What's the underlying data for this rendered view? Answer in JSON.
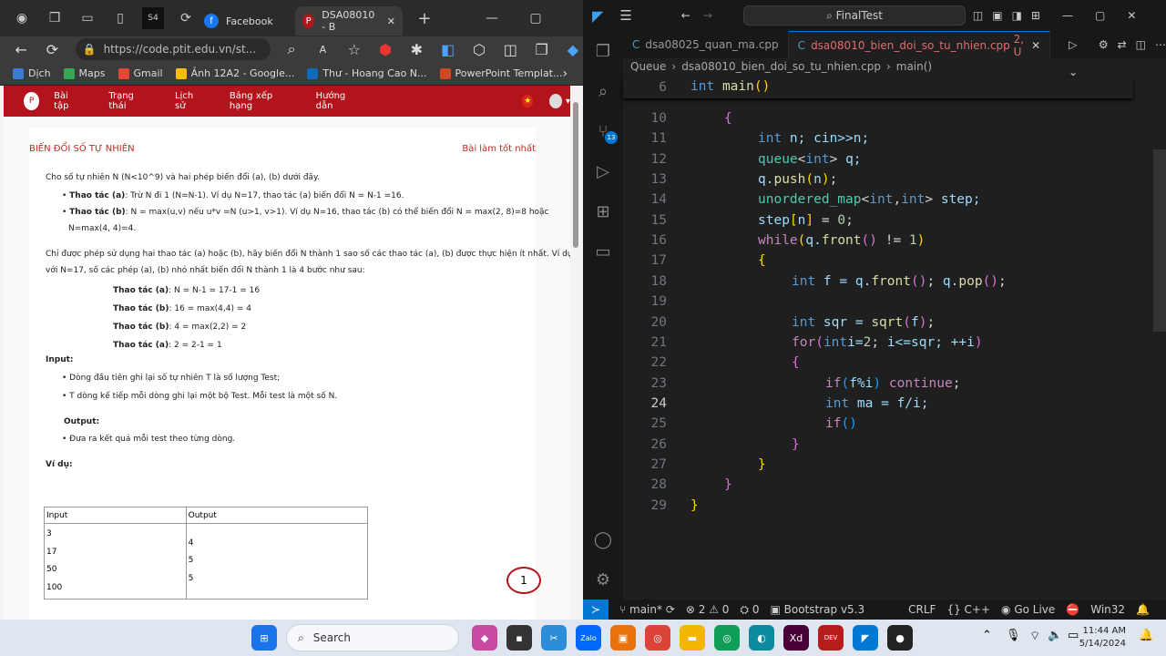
{
  "browser": {
    "tabs": [
      {
        "label": "Facebook",
        "color": "#1877f2",
        "glyph": "f"
      },
      {
        "label": "DSA08010 - B",
        "color": "#b3131b",
        "glyph": "P"
      }
    ],
    "url": "https://code.ptit.edu.vn/st...",
    "bookmarks": [
      {
        "label": "Dịch",
        "color": "#3a7bd5"
      },
      {
        "label": "Maps",
        "color": "#34a853"
      },
      {
        "label": "Gmail",
        "color": "#ea4335"
      },
      {
        "label": "Ảnh 12A2 - Google...",
        "color": "#fbbc04"
      },
      {
        "label": "Thư - Hoang Cao N...",
        "color": "#0f6cbd"
      },
      {
        "label": "PowerPoint Templat...",
        "color": "#d24726"
      }
    ]
  },
  "site": {
    "nav": [
      "Bài tập",
      "Trạng thái",
      "Lịch sử",
      "Bảng xếp hạng",
      "Hướng dẫn"
    ],
    "title": "BIẾN ĐỔI SỐ TỰ NHIÊN",
    "best": "Bài làm tốt nhất",
    "intro": "Cho số tự nhiên N (N<10^9) và hai phép biến đổi (a), (b) dưới đây.",
    "op_a_label": "Thao tác (a)",
    "op_a": ": Trừ N đi 1 (N=N-1). Ví dụ N=17, thao tác (a) biến đổi N = N-1 =16.",
    "op_b_label": "Thao tác (b)",
    "op_b1": ": N = max(u,v) nếu u*v =N (u>1, v>1). Ví dụ N=16, thao tác (b) có thể biến đổi N = max(2, 8)=8 hoặc",
    "op_b2": "N=max(4, 4)=4.",
    "para1": "Chỉ được phép sử dụng hai thao tác (a) hoặc (b), hãy biến đổi N thành 1 sao số các thao tác (a), (b) được thực hiện ít nhất. Ví dụ",
    "para2": "với N=17, số các phép (a), (b) nhỏ nhất biến đổi N thành 1 là 4 bước như sau:",
    "steps": [
      {
        "label": "Thao tác (a)",
        "text": ": N = N-1 = 17-1 = 16"
      },
      {
        "label": "Thao tác (b)",
        "text": ": 16 = max(4,4) = 4"
      },
      {
        "label": "Thao tác (b)",
        "text": ": 4 = max(2,2) = 2"
      },
      {
        "label": "Thao tác (a)",
        "text": ": 2 = 2-1 = 1"
      }
    ],
    "input_h": "Input:",
    "input1": "Dòng đầu tiên ghi lại số tự nhiên T là số lượng Test;",
    "input2": "T dòng kế tiếp mỗi dòng ghi lại một bộ Test. Mỗi test là một số N.",
    "output_h": "Output:",
    "output1": "Đưa ra kết quả mỗi test theo từng dòng.",
    "example_h": "Ví dụ:",
    "table": {
      "h_in": "Input",
      "h_out": "Output",
      "inputs": [
        "3",
        "17",
        "50",
        "100"
      ],
      "outputs": [
        "4",
        "5",
        "5"
      ]
    },
    "chat_count": "1"
  },
  "vscode": {
    "search": "FinalTest",
    "tabs": [
      {
        "label": "dsa08025_quan_ma.cpp",
        "active": false
      },
      {
        "label": "dsa08010_bien_doi_so_tu_nhien.cpp",
        "active": true,
        "badge": "2, U"
      }
    ],
    "breadcrumb": [
      "Queue",
      "›",
      "dsa08010_bien_doi_so_tu_nhien.cpp",
      "›",
      "main()"
    ],
    "scm_badge": "13",
    "sticky_line": "6",
    "sticky_code": "int main()",
    "current_line": "24",
    "lines": [
      {
        "n": "10",
        "indent": 1
      },
      {
        "n": "11",
        "indent": 2
      },
      {
        "n": "12",
        "indent": 2
      },
      {
        "n": "13",
        "indent": 2
      },
      {
        "n": "14",
        "indent": 2
      },
      {
        "n": "15",
        "indent": 2
      },
      {
        "n": "16",
        "indent": 2
      },
      {
        "n": "17",
        "indent": 2
      },
      {
        "n": "18",
        "indent": 3
      },
      {
        "n": "19",
        "indent": 0
      },
      {
        "n": "20",
        "indent": 3
      },
      {
        "n": "21",
        "indent": 3
      },
      {
        "n": "22",
        "indent": 3
      },
      {
        "n": "23",
        "indent": 4
      },
      {
        "n": "24",
        "indent": 4
      },
      {
        "n": "25",
        "indent": 4
      },
      {
        "n": "26",
        "indent": 3
      },
      {
        "n": "27",
        "indent": 2
      },
      {
        "n": "28",
        "indent": 1
      },
      {
        "n": "29",
        "indent": 0
      }
    ],
    "status": {
      "branch": "main*",
      "errors": "2",
      "warnings": "0",
      "ports": "0",
      "bootstrap": "Bootstrap v5.3",
      "eol": "CRLF",
      "lang": "C++",
      "golive": "Go Live",
      "platform": "Win32"
    }
  },
  "taskbar": {
    "search": "Search",
    "time": "11:44 AM",
    "date": "5/14/2024"
  }
}
